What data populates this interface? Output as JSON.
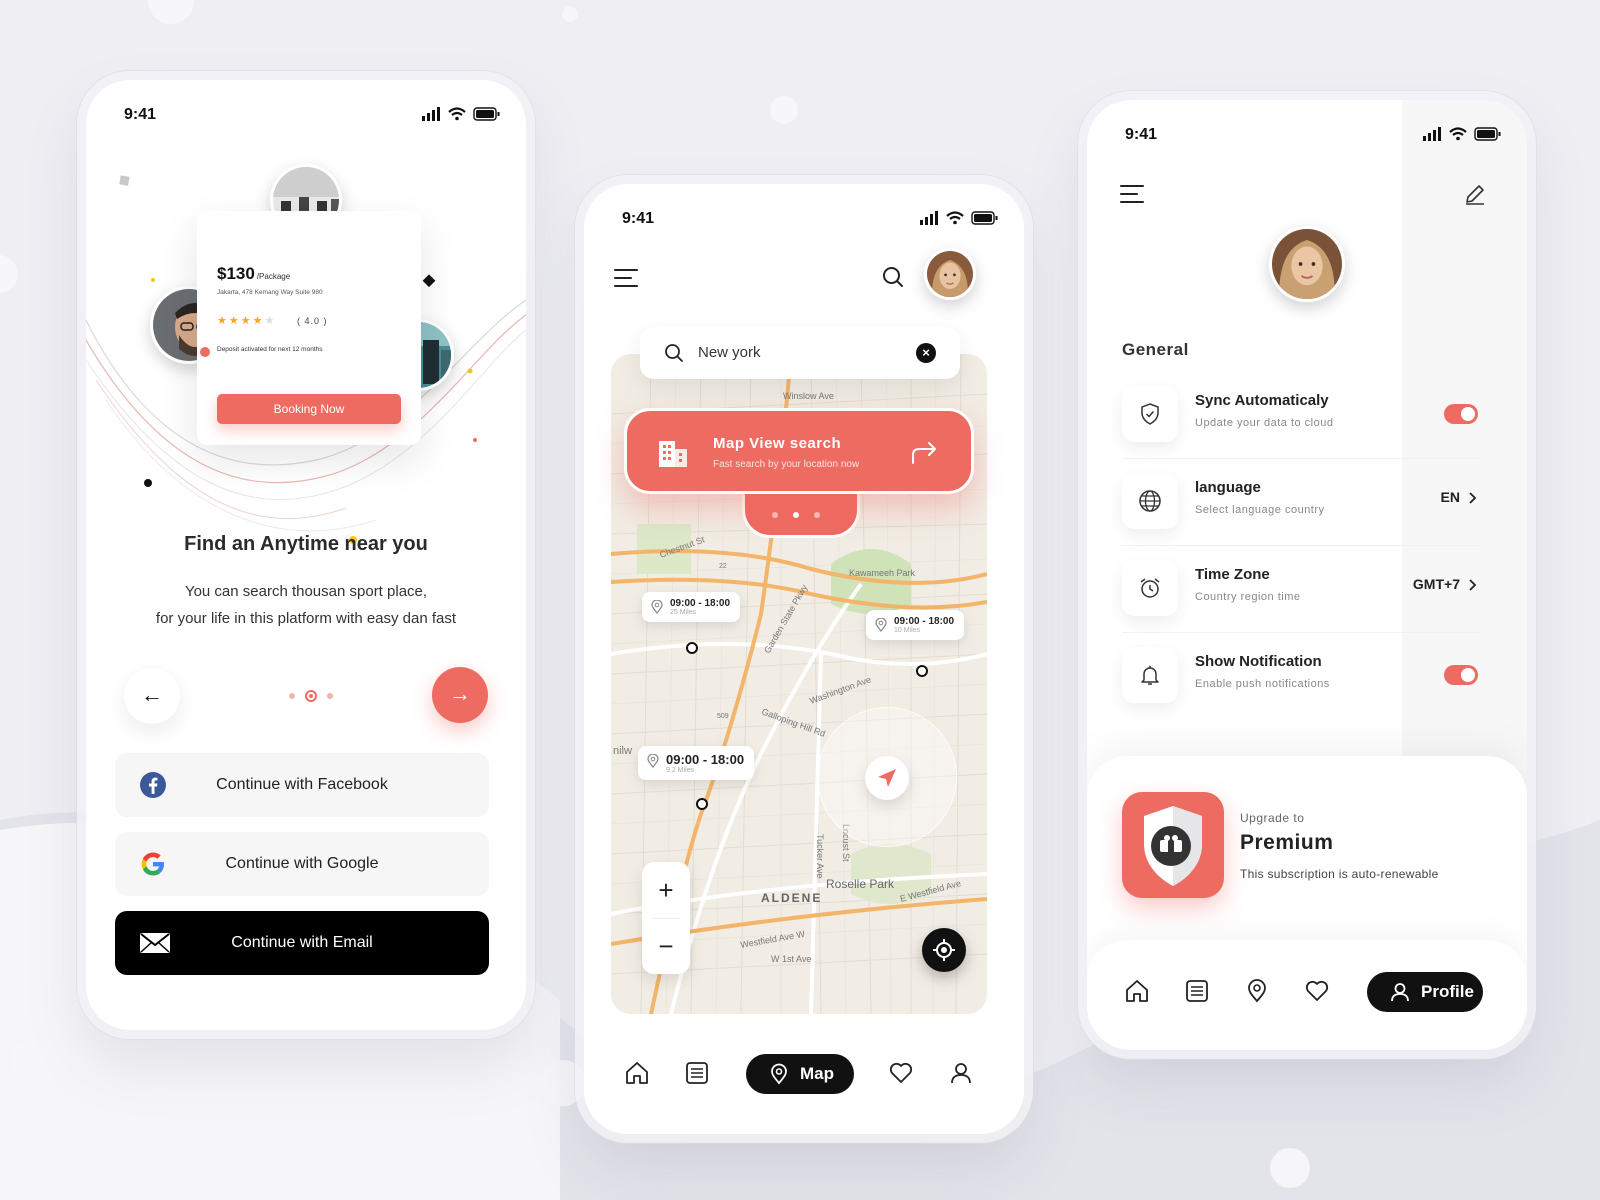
{
  "colors": {
    "accent": "#ee6b62",
    "dark": "#111111",
    "background": "#eeeef3",
    "map_base": "#f1ece4",
    "map_road": "#f3b56a",
    "map_park": "#cfe2b8"
  },
  "phone1": {
    "status_time": "9:41",
    "card": {
      "price": "$130",
      "price_unit": "/Package",
      "address": "Jakarta, 478 Kemang Way Suite 980",
      "stars_filled": 4,
      "stars_total": 5,
      "rating": "( 4.0 )",
      "deposit_note": "Deposit activated for next 12 months",
      "booking_label": "Booking Now"
    },
    "title": "Find an Anytime near you",
    "description_line1": "You can search thousan sport place,",
    "description_line2": "for your life in this platform with easy dan fast",
    "pager": {
      "active_index": 1,
      "count": 3
    },
    "prev_icon": "arrow-left-icon",
    "next_icon": "arrow-right-icon",
    "buttons": {
      "facebook": "Continue with Facebook",
      "google": "Continue with Google",
      "email": "Continue with Email"
    }
  },
  "phone2": {
    "status_time": "9:41",
    "search": {
      "value": "New york"
    },
    "banner": {
      "title": "Map View search",
      "subtitle": "Fast search by your location now",
      "active_dot": 1
    },
    "pins": [
      {
        "time": "09:00 - 18:00",
        "distance": "25 Miles"
      },
      {
        "time": "09:00 - 18:00",
        "distance": "10 Miles"
      },
      {
        "time": "09:00 - 18:00",
        "distance": "9.2 Miles"
      }
    ],
    "map_labels": {
      "aldene": "ALDENE",
      "roselle_park": "Roselle Park",
      "kawameeh_park": "Kawameeh Park",
      "garden_state": "Garden State Pkwy",
      "westfield": "Westfield Ave W",
      "e_westfield": "E Westfield Ave",
      "winslow": "Winslow Ave",
      "washington": "Washington Ave",
      "galloping": "Galloping Hill Rd",
      "chestnut": "Chestnut St",
      "tucker": "Tucker Ave",
      "locust": "Locust St",
      "w1st": "W 1st Ave",
      "route22": "22",
      "route509": "509",
      "union": "nion",
      "nilw": "nilw"
    },
    "zoom_in": "+",
    "zoom_out": "−",
    "tabs": {
      "active": "Map"
    }
  },
  "phone3": {
    "status_time": "9:41",
    "section": "General",
    "settings": [
      {
        "title": "Sync Automaticaly",
        "subtitle": "Update your data to cloud",
        "toggle": true
      },
      {
        "title": "language",
        "subtitle": "Select language country",
        "value": "EN"
      },
      {
        "title": "Time Zone",
        "subtitle": "Country region time",
        "value": "GMT+7"
      },
      {
        "title": "Show Notification",
        "subtitle": "Enable push notifications",
        "toggle": true
      }
    ],
    "premium": {
      "upgrade": "Upgrade to",
      "title": "Premium",
      "subtitle": "This subscription is auto-renewable"
    },
    "tabs": {
      "active": "Profile"
    }
  }
}
